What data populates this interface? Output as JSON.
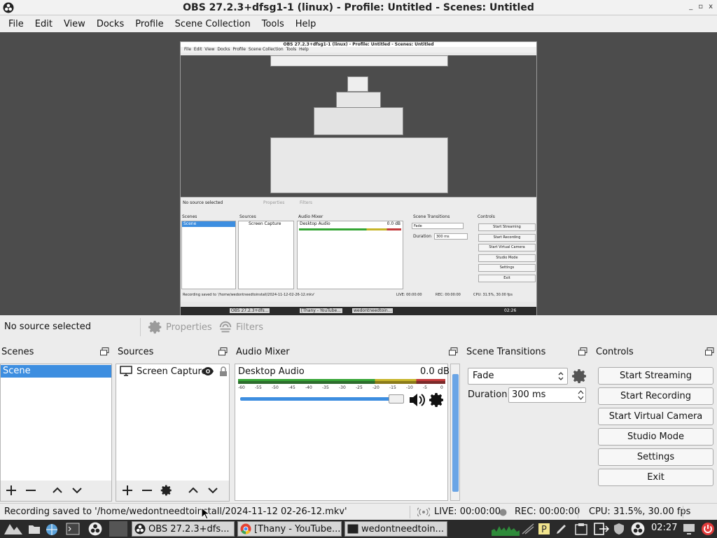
{
  "window": {
    "title": "OBS 27.2.3+dfsg1-1 (linux) - Profile: Untitled - Scenes: Untitled",
    "controls": [
      "_",
      "▫",
      "x"
    ]
  },
  "menu": [
    "File",
    "Edit",
    "View",
    "Docks",
    "Profile",
    "Scene Collection",
    "Tools",
    "Help"
  ],
  "preview_mirror": {
    "title": "OBS 27.2.3+dfsg1-1 (linux) - Profile: Untitled - Scenes: Untitled",
    "no_source": "No source selected",
    "properties": "Properties",
    "filters": "Filters",
    "scenes": "Scenes",
    "sources": "Sources",
    "audio_mixer": "Audio Mixer",
    "scene_transitions": "Scene Transitions",
    "controls": "Controls",
    "scene_item": "Scene",
    "source_item": "Screen Capture",
    "mixer_track": "Desktop Audio",
    "mixer_db": "0.0 dB",
    "transition": "Fade",
    "duration_label": "Duration",
    "duration": "300 ms",
    "buttons": [
      "Start Streaming",
      "Start Recording",
      "Start Virtual Camera",
      "Studio Mode",
      "Settings",
      "Exit"
    ],
    "status_text": "Recording saved to '/home/wedontneedtoinstall/2024-11-12-02-26-12.mkv'",
    "live": "LIVE: 00:00:00",
    "rec": "REC: 00:00:00",
    "cpu": "CPU: 31.5%, 30.00 fps",
    "tasks": [
      "OBS 27.2.3+dfs...",
      "[Thany - YouTube...",
      "wedontneedtoin..."
    ],
    "clock": "02:26"
  },
  "props_bar": {
    "no_source": "No source selected",
    "properties": "Properties",
    "filters": "Filters"
  },
  "docks": {
    "scenes": {
      "title": "Scenes",
      "items": [
        "Scene"
      ]
    },
    "sources": {
      "title": "Sources",
      "items": [
        {
          "name": "Screen Capture"
        }
      ]
    },
    "mixer": {
      "title": "Audio Mixer",
      "track": "Desktop Audio",
      "db": "0.0 dB",
      "ticks": [
        "-60",
        "-55",
        "-50",
        "-45",
        "-40",
        "-35",
        "-30",
        "-25",
        "-20",
        "-15",
        "-10",
        "-5",
        "0"
      ],
      "volume_percent": 100
    },
    "transitions": {
      "title": "Scene Transitions",
      "selected": "Fade",
      "duration_label": "Duration",
      "duration": "300 ms"
    },
    "controls": {
      "title": "Controls",
      "start_streaming": "Start Streaming",
      "start_recording": "Start Recording",
      "start_virtual_camera": "Start Virtual Camera",
      "studio_mode": "Studio Mode",
      "settings": "Settings",
      "exit": "Exit"
    }
  },
  "status": {
    "message": "Recording saved to '/home/wedontneedtoinstall/2024-11-12 02-26-12.mkv'",
    "live": "LIVE: 00:00:00",
    "rec": "REC: 00:00:00",
    "cpu": "CPU: 31.5%, 30.00 fps"
  },
  "taskbar": {
    "tasks": [
      "OBS 27.2.3+dfs...",
      "[Thany - YouTube...",
      "wedontneedtoin..."
    ],
    "clock": "02:27"
  },
  "colors": {
    "accent": "#3d8ee0",
    "preview_bg": "#4c4c4c",
    "taskbar": "#2a2a2a"
  }
}
